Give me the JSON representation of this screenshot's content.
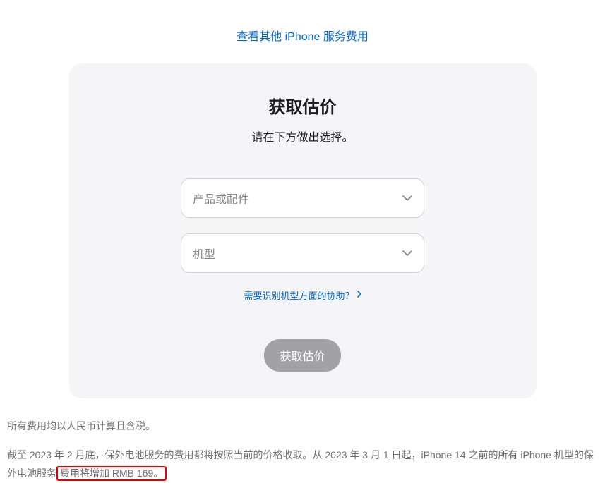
{
  "topLink": {
    "label": "查看其他 iPhone 服务费用"
  },
  "card": {
    "title": "获取估价",
    "subtitle": "请在下方做出选择。",
    "selects": {
      "product": {
        "placeholder": "产品或配件"
      },
      "model": {
        "placeholder": "机型"
      }
    },
    "helpLink": {
      "label": "需要识别机型方面的协助？"
    },
    "submit": {
      "label": "获取估价"
    }
  },
  "notes": {
    "line1": "所有费用均以人民币计算且含税。",
    "line2_part1": "截至 2023 年 2 月底，保外电池服务的费用都将按照当前的价格收取。从 2023 年 3 月 1 日起，iPhone 14 之前的所有 iPhone 机型的保外电池服务",
    "line2_highlight": "费用将增加 RMB 169。"
  }
}
